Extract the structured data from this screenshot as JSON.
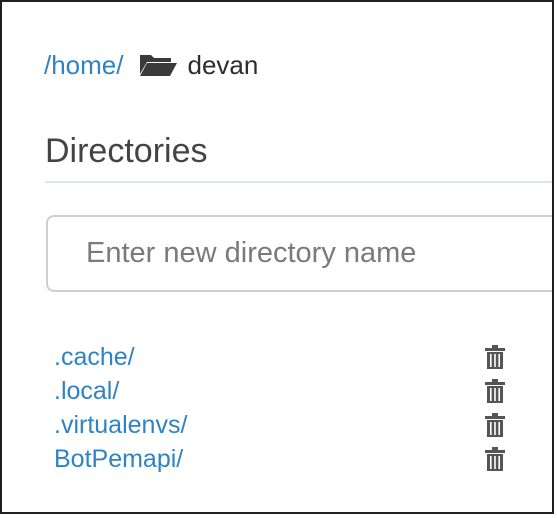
{
  "breadcrumb": {
    "parent_label": "/home/",
    "folder_icon": "folder-open-icon",
    "current_label": "devan"
  },
  "directories": {
    "title": "Directories",
    "input_placeholder": "Enter new directory name",
    "input_value": "",
    "items": [
      {
        "label": ".cache/",
        "delete_icon": "trash-icon"
      },
      {
        "label": ".local/",
        "delete_icon": "trash-icon"
      },
      {
        "label": ".virtualenvs/",
        "delete_icon": "trash-icon"
      },
      {
        "label": "BotPemapi/",
        "delete_icon": "trash-icon"
      }
    ]
  },
  "colors": {
    "link": "#2f83c4",
    "rule": "#d5e8f3",
    "input_border": "#cfcfcf"
  }
}
